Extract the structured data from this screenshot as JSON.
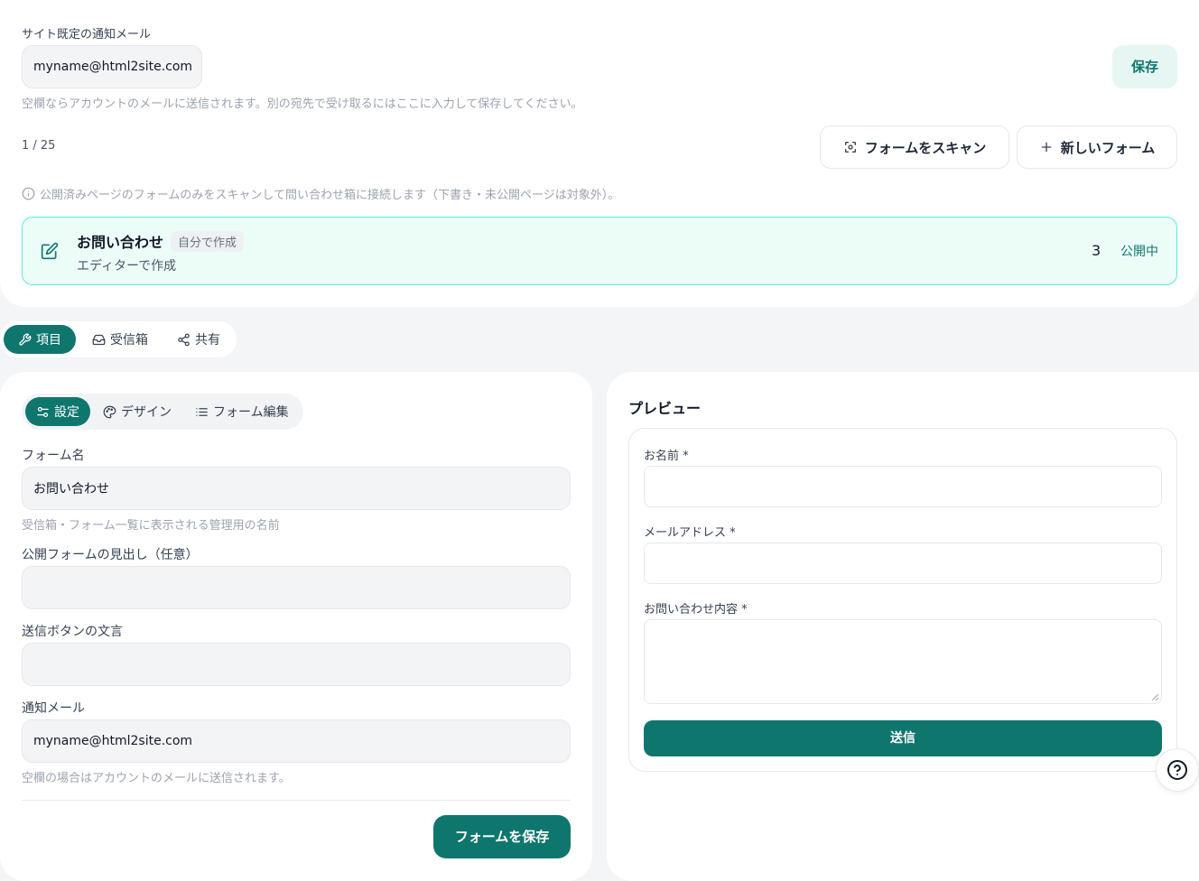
{
  "settings": {
    "notify_label": "サイト既定の通知メール",
    "notify_email": "myname@html2site.com",
    "save_label": "保存",
    "notify_hint": "空欄ならアカウントのメールに送信されます。別の宛先で受け取るにはここに入力して保存してください。"
  },
  "forms_list": {
    "count": "1 / 25",
    "scan_label": "フォームをスキャン",
    "new_label": "新しいフォーム",
    "scan_note": "公開済みページのフォームのみをスキャンして問い合わせ箱に接続します（下書き・未公開ページは対象外）。",
    "items": [
      {
        "title": "お問い合わせ",
        "badge": "自分で作成",
        "subtitle": "エディターで作成",
        "count": "3",
        "status": "公開中"
      }
    ]
  },
  "main_tabs": [
    {
      "label": "項目"
    },
    {
      "label": "受信箱"
    },
    {
      "label": "共有"
    }
  ],
  "editor": {
    "subtabs": [
      {
        "label": "設定"
      },
      {
        "label": "デザイン"
      },
      {
        "label": "フォーム編集"
      }
    ],
    "form_name_label": "フォーム名",
    "form_name_value": "お問い合わせ",
    "form_name_hint": "受信箱・フォーム一覧に表示される管理用の名前",
    "heading_label": "公開フォームの見出し（任意）",
    "heading_value": "",
    "submit_text_label": "送信ボタンの文言",
    "submit_text_value": "",
    "notify_label": "通知メール",
    "notify_value": "myname@html2site.com",
    "notify_hint": "空欄の場合はアカウントのメールに送信されます。",
    "save_form_label": "フォームを保存"
  },
  "preview": {
    "title": "プレビュー",
    "fields": [
      {
        "label": "お名前 *"
      },
      {
        "label": "メールアドレス *"
      },
      {
        "label": "お問い合わせ内容 *"
      }
    ],
    "submit_label": "送信"
  },
  "colors": {
    "accent": "#0f766e",
    "accent_light": "#e6f7f3",
    "selected_border": "#5eead4",
    "selected_bg": "#ecfdf8"
  },
  "icons": {
    "scan": "scan-icon",
    "plus": "plus-icon",
    "info": "info-icon",
    "edit": "edit-icon",
    "items": "tools-icon",
    "inbox": "inbox-icon",
    "share": "share-icon",
    "settings": "sliders-icon",
    "design": "palette-icon",
    "form_edit": "list-icon",
    "help": "help-icon"
  }
}
